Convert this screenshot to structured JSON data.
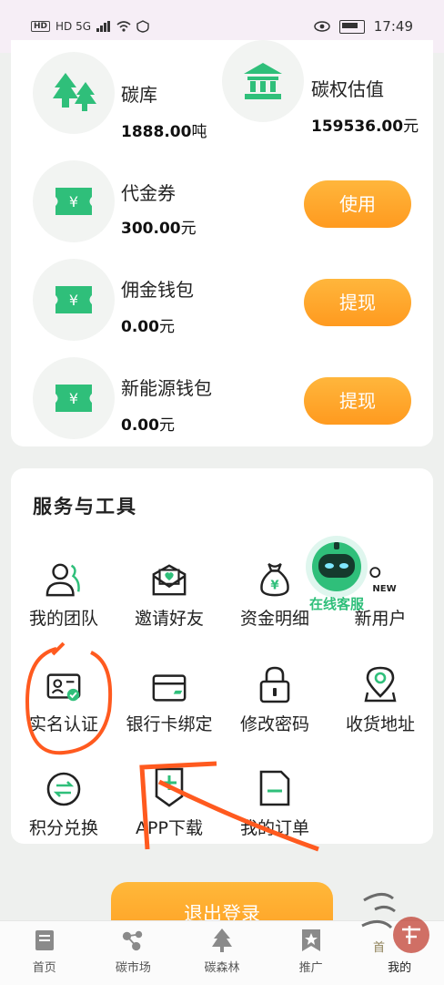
{
  "status_bar": {
    "left_text": "HD 5G",
    "time": "17:49"
  },
  "assets": [
    {
      "title": "碳库",
      "value": "1888.00",
      "unit": "吨",
      "icon": "trees-icon"
    },
    {
      "title": "碳权估值",
      "value": "159536.00",
      "unit": "元",
      "icon": "bank-icon"
    }
  ],
  "wallets": [
    {
      "title": "代金券",
      "value": "300.00",
      "unit": "元",
      "button": "使用",
      "icon": "ticket-icon"
    },
    {
      "title": "佣金钱包",
      "value": "0.00",
      "unit": "元",
      "button": "提现",
      "icon": "ticket-icon"
    },
    {
      "title": "新能源钱包",
      "value": "0.00",
      "unit": "元",
      "button": "提现",
      "icon": "ticket-icon"
    }
  ],
  "services": {
    "title": "服务与工具",
    "items": [
      {
        "label": "我的团队",
        "icon": "team-icon"
      },
      {
        "label": "邀请好友",
        "icon": "invite-envelope-icon"
      },
      {
        "label": "资金明细",
        "icon": "money-bag-icon"
      },
      {
        "label": "新用户",
        "icon": "new-user-icon",
        "badge": "NEW"
      },
      {
        "label": "实名认证",
        "icon": "id-card-icon"
      },
      {
        "label": "银行卡绑定",
        "icon": "bank-card-icon"
      },
      {
        "label": "修改密码",
        "icon": "lock-icon"
      },
      {
        "label": "收货地址",
        "icon": "location-pin-icon"
      },
      {
        "label": "积分兑换",
        "icon": "exchange-icon"
      },
      {
        "label": "APP下载",
        "icon": "download-plus-icon"
      },
      {
        "label": "我的订单",
        "icon": "order-doc-icon"
      }
    ]
  },
  "customer_service": {
    "label": "在线客服",
    "icon": "robot-icon"
  },
  "logout_label": "退出登录",
  "tabs": [
    {
      "label": "首页",
      "icon": "home-doc-icon"
    },
    {
      "label": "碳市场",
      "icon": "market-nodes-icon"
    },
    {
      "label": "碳森林",
      "icon": "forest-icon"
    },
    {
      "label": "推广",
      "icon": "promote-star-icon"
    },
    {
      "label": "我的",
      "icon": "profile-icon"
    }
  ],
  "watermark": {
    "icon": "seal-watermark-icon"
  },
  "colors": {
    "green": "#2fbf7a",
    "orange": "#ff9e22",
    "annotation": "#ff5a1f"
  }
}
